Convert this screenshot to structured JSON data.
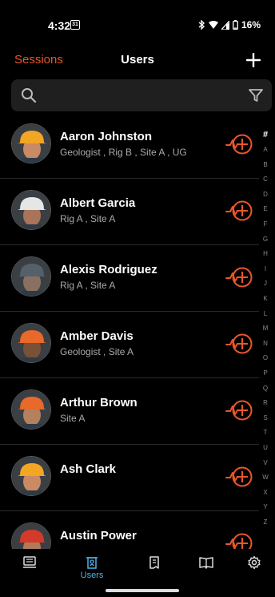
{
  "status_bar": {
    "time": "4:32",
    "calendar_day": "31",
    "battery": "16%"
  },
  "header": {
    "back_label": "Sessions",
    "title": "Users"
  },
  "search": {
    "placeholder": ""
  },
  "users": [
    {
      "name": "Aaron Johnston",
      "subtitle": "Geologist , Rig B , Site A , UG",
      "helmet": "#f2a623",
      "skin": "#c98a64"
    },
    {
      "name": "Albert Garcia",
      "subtitle": "Rig A , Site A",
      "helmet": "#e6e6e6",
      "skin": "#a9745a"
    },
    {
      "name": "Alexis Rodriguez",
      "subtitle": "Rig A , Site A",
      "helmet": "#55606a",
      "skin": "#8a7060"
    },
    {
      "name": "Amber Davis",
      "subtitle": "Geologist , Site A",
      "helmet": "#e8692a",
      "skin": "#7a5038"
    },
    {
      "name": "Arthur Brown",
      "subtitle": "Site A",
      "helmet": "#e8692a",
      "skin": "#b4805e"
    },
    {
      "name": "Ash Clark",
      "subtitle": "",
      "helmet": "#f2a623",
      "skin": "#c98a64"
    },
    {
      "name": "Austin Power",
      "subtitle": "",
      "helmet": "#d33a2a",
      "skin": "#b07a5a"
    }
  ],
  "alpha_index": [
    "#",
    "A",
    "B",
    "C",
    "D",
    "E",
    "F",
    "G",
    "H",
    "I",
    "J",
    "K",
    "L",
    "M",
    "N",
    "O",
    "P",
    "Q",
    "R",
    "S",
    "T",
    "U",
    "V",
    "W",
    "X",
    "Y",
    "Z"
  ],
  "tabs": [
    {
      "id": "sessions",
      "label": "",
      "icon": "monitor-icon"
    },
    {
      "id": "users",
      "label": "Users",
      "icon": "id-badge-icon",
      "active": true
    },
    {
      "id": "reports",
      "label": "",
      "icon": "document-icon"
    },
    {
      "id": "library",
      "label": "",
      "icon": "open-book-icon"
    },
    {
      "id": "settings",
      "label": "",
      "icon": "gear-icon"
    }
  ],
  "colors": {
    "accent": "#e8562a",
    "active_tab": "#4fb3e8",
    "background": "#000000",
    "search_bg": "#1f1f1f"
  }
}
